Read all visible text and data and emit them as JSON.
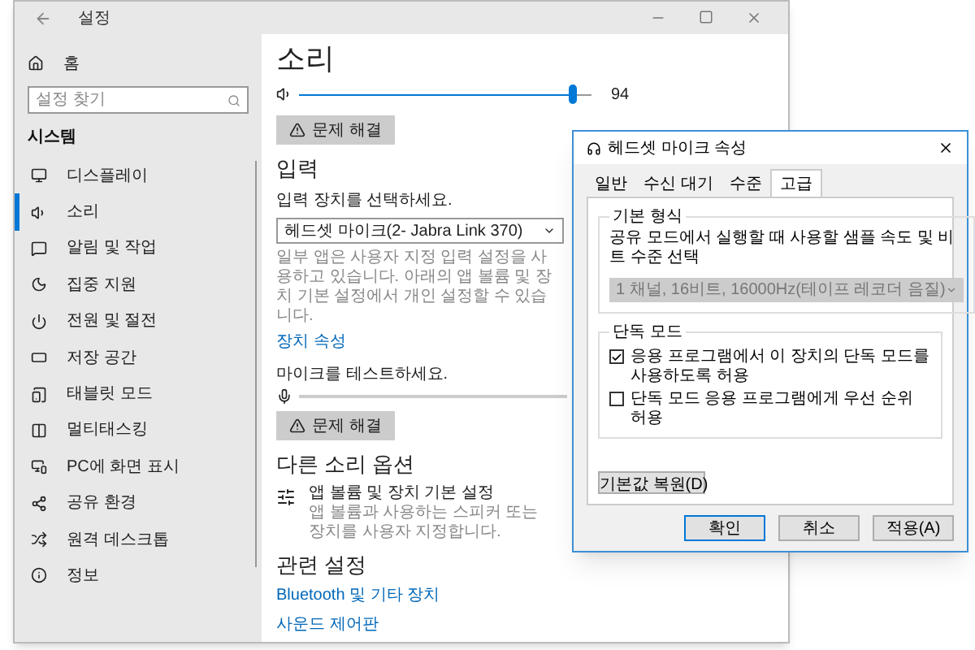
{
  "window": {
    "title": "설정"
  },
  "sidebar": {
    "home": "홈",
    "search": {
      "placeholder": "설정 찾기"
    },
    "section": "시스템",
    "items": [
      {
        "label": "디스플레이",
        "selected": false
      },
      {
        "label": "소리",
        "selected": true
      },
      {
        "label": "알림 및 작업",
        "selected": false
      },
      {
        "label": "집중 지원",
        "selected": false
      },
      {
        "label": "전원 및 절전",
        "selected": false
      },
      {
        "label": "저장 공간",
        "selected": false
      },
      {
        "label": "태블릿 모드",
        "selected": false
      },
      {
        "label": "멀티태스킹",
        "selected": false
      },
      {
        "label": "PC에 화면 표시",
        "selected": false
      },
      {
        "label": "공유 환경",
        "selected": false
      },
      {
        "label": "원격 데스크톱",
        "selected": false
      },
      {
        "label": "정보",
        "selected": false
      }
    ]
  },
  "sound": {
    "title": "소리",
    "volume": {
      "level": 0.94,
      "reading": "94"
    },
    "troubleshoot": "문제 해결"
  },
  "input": {
    "heading": "입력",
    "select_label": "입력 장치를 선택하세요.",
    "device": "헤드셋 마이크(2- Jabra Link 370)",
    "note": "일부 앱은 사용자 지정 입력 설정을 사용하고 있습니다. 아래의 앱 볼륨 및 장치 기본 설정에서 개인 설정할 수 있습니다.",
    "link": "장치 속성",
    "test_label": "마이크를 테스트하세요.",
    "troubleshoot": "문제 해결"
  },
  "other": {
    "heading": "다른 소리 옵션",
    "item": {
      "title": "앱 볼륨 및 장치 기본 설정",
      "subtitle": "앱 볼륨과 사용하는 스피커 또는 장치를 사용자 지정합니다."
    }
  },
  "related": {
    "heading": "관련 설정",
    "links": [
      "Bluetooth 및 기타 장치",
      "사운드 제어판"
    ]
  },
  "dialog": {
    "title": "헤드셋 마이크 속성",
    "tabs": [
      {
        "label": "일반",
        "selected": false
      },
      {
        "label": "수신 대기",
        "selected": false
      },
      {
        "label": "수준",
        "selected": false
      },
      {
        "label": "고급",
        "selected": true
      }
    ],
    "format": {
      "legend": "기본 형식",
      "text": "공유 모드에서 실행할 때 사용할 샘플 속도 및 비트 수준 선택",
      "value": "1 채널, 16비트, 16000Hz(테이프 레코더 음질)",
      "disabled": true
    },
    "exclusive": {
      "legend": "단독 모드",
      "options": [
        {
          "label": "응용 프로그램에서 이 장치의 단독 모드를 사용하도록 허용",
          "checked": true
        },
        {
          "label": "단독 모드 응용 프로그램에게 우선 순위 허용",
          "checked": false
        }
      ]
    },
    "restore": "기본값 복원(D)",
    "buttons": [
      "확인",
      "취소",
      "적용(A)"
    ]
  }
}
